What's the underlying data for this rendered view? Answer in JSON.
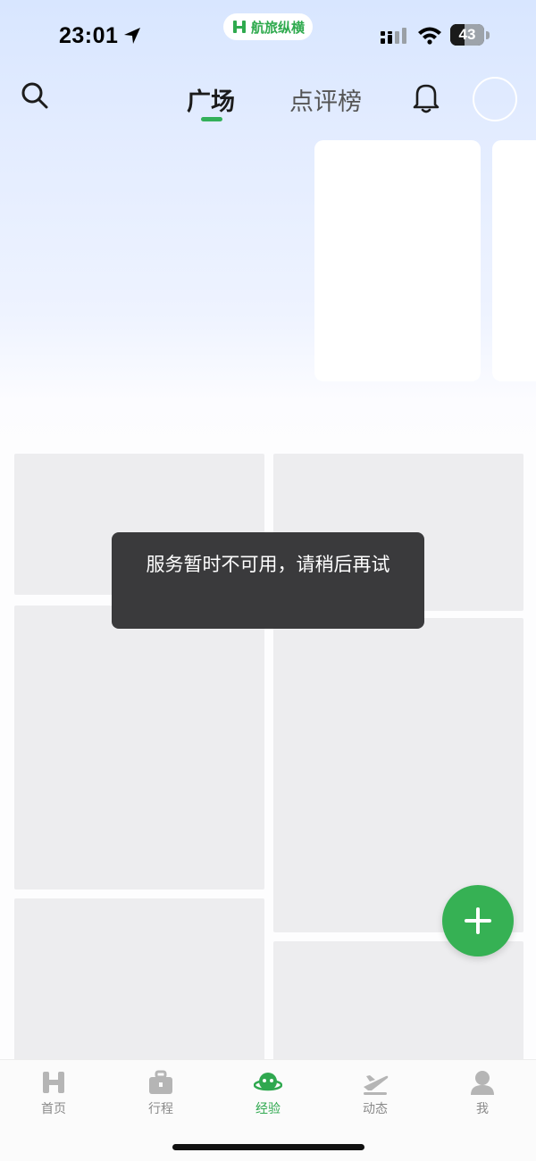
{
  "status_bar": {
    "time": "23:01",
    "brand": "航旅纵横",
    "battery_level": "43"
  },
  "header": {
    "tabs": [
      {
        "label": "广场",
        "active": true
      },
      {
        "label": "点评榜",
        "active": false
      }
    ]
  },
  "toast": {
    "message": "服务暂时不可用，请稍后再试"
  },
  "tab_bar": {
    "items": [
      {
        "label": "首页",
        "icon": "home-logo-icon",
        "active": false
      },
      {
        "label": "行程",
        "icon": "briefcase-icon",
        "active": false
      },
      {
        "label": "经验",
        "icon": "planet-mascot-icon",
        "active": true
      },
      {
        "label": "动态",
        "icon": "airplane-icon",
        "active": false
      },
      {
        "label": "我",
        "icon": "person-icon",
        "active": false
      }
    ]
  },
  "colors": {
    "accent_green": "#36b154",
    "toast_bg": "#3a3a3c",
    "placeholder_gray": "#ededef",
    "header_gradient_top": "#d8e6ff"
  }
}
